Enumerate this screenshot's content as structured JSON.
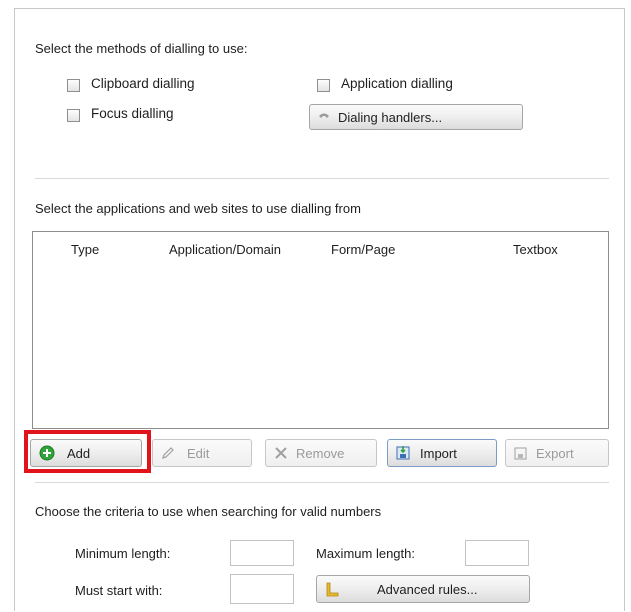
{
  "methods": {
    "heading": "Select the methods of dialling to use:",
    "clipboard_label": "Clipboard dialling",
    "focus_label": "Focus dialling",
    "application_label": "Application dialling",
    "handlers_button": "Dialing handlers..."
  },
  "apps": {
    "heading": "Select the applications and web sites to use dialling from",
    "columns": [
      "Type",
      "Application/Domain",
      "Form/Page",
      "Textbox"
    ]
  },
  "toolbar": {
    "add": "Add",
    "edit": "Edit",
    "remove": "Remove",
    "import": "Import",
    "export": "Export"
  },
  "criteria": {
    "heading": "Choose the criteria to use when searching for valid numbers",
    "min_label": "Minimum length:",
    "max_label": "Maximum length:",
    "start_label": "Must start with:",
    "advanced_button": "Advanced rules..."
  },
  "colors": {
    "highlight": "#e1141b",
    "add_icon": "#2fa43a"
  }
}
